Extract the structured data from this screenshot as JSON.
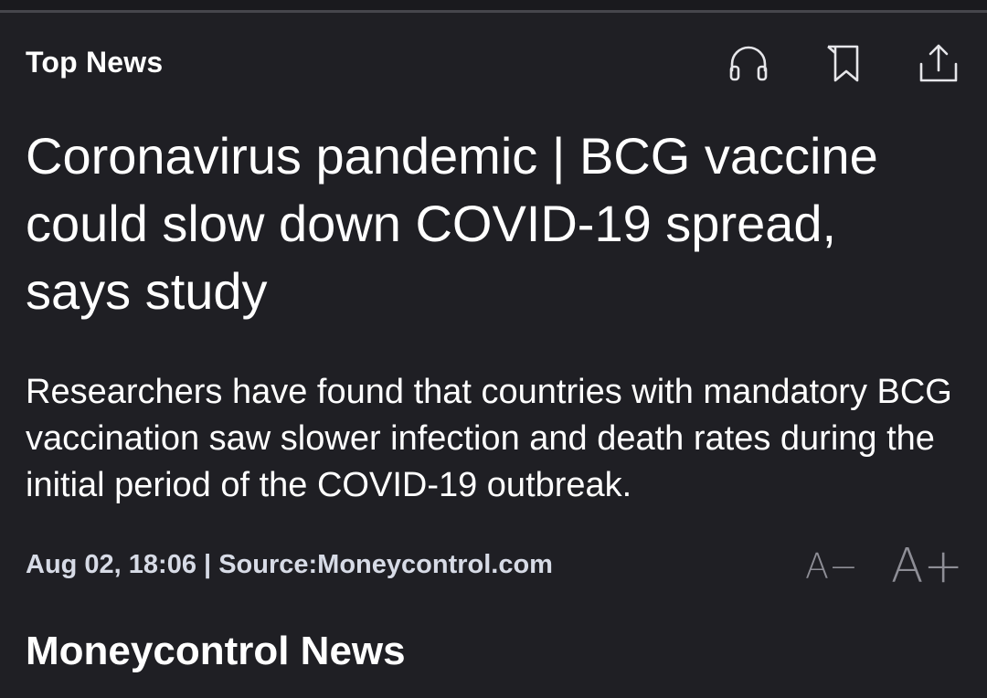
{
  "header": {
    "section_label": "Top News"
  },
  "toolbar": {
    "listen_icon": "headphones-icon",
    "bookmark_icon": "bookmark-icon",
    "share_icon": "share-icon"
  },
  "article": {
    "headline": "Coronavirus pandemic | BCG vaccine could slow down COVID-19 spread, says study",
    "summary": "Researchers have found that countries with mandatory BCG vaccination saw slower infection and death rates during the initial period of the COVID-19 outbreak.",
    "meta": "Aug 02, 18:06 | Source:Moneycontrol.com",
    "author": "Moneycontrol News"
  },
  "font_controls": {
    "decrease_label": "A−",
    "increase_label": "A+"
  },
  "colors": {
    "background": "#1f1f24",
    "text": "#ffffff",
    "meta_text": "#d7dbe6",
    "muted": "#8e8e96"
  }
}
